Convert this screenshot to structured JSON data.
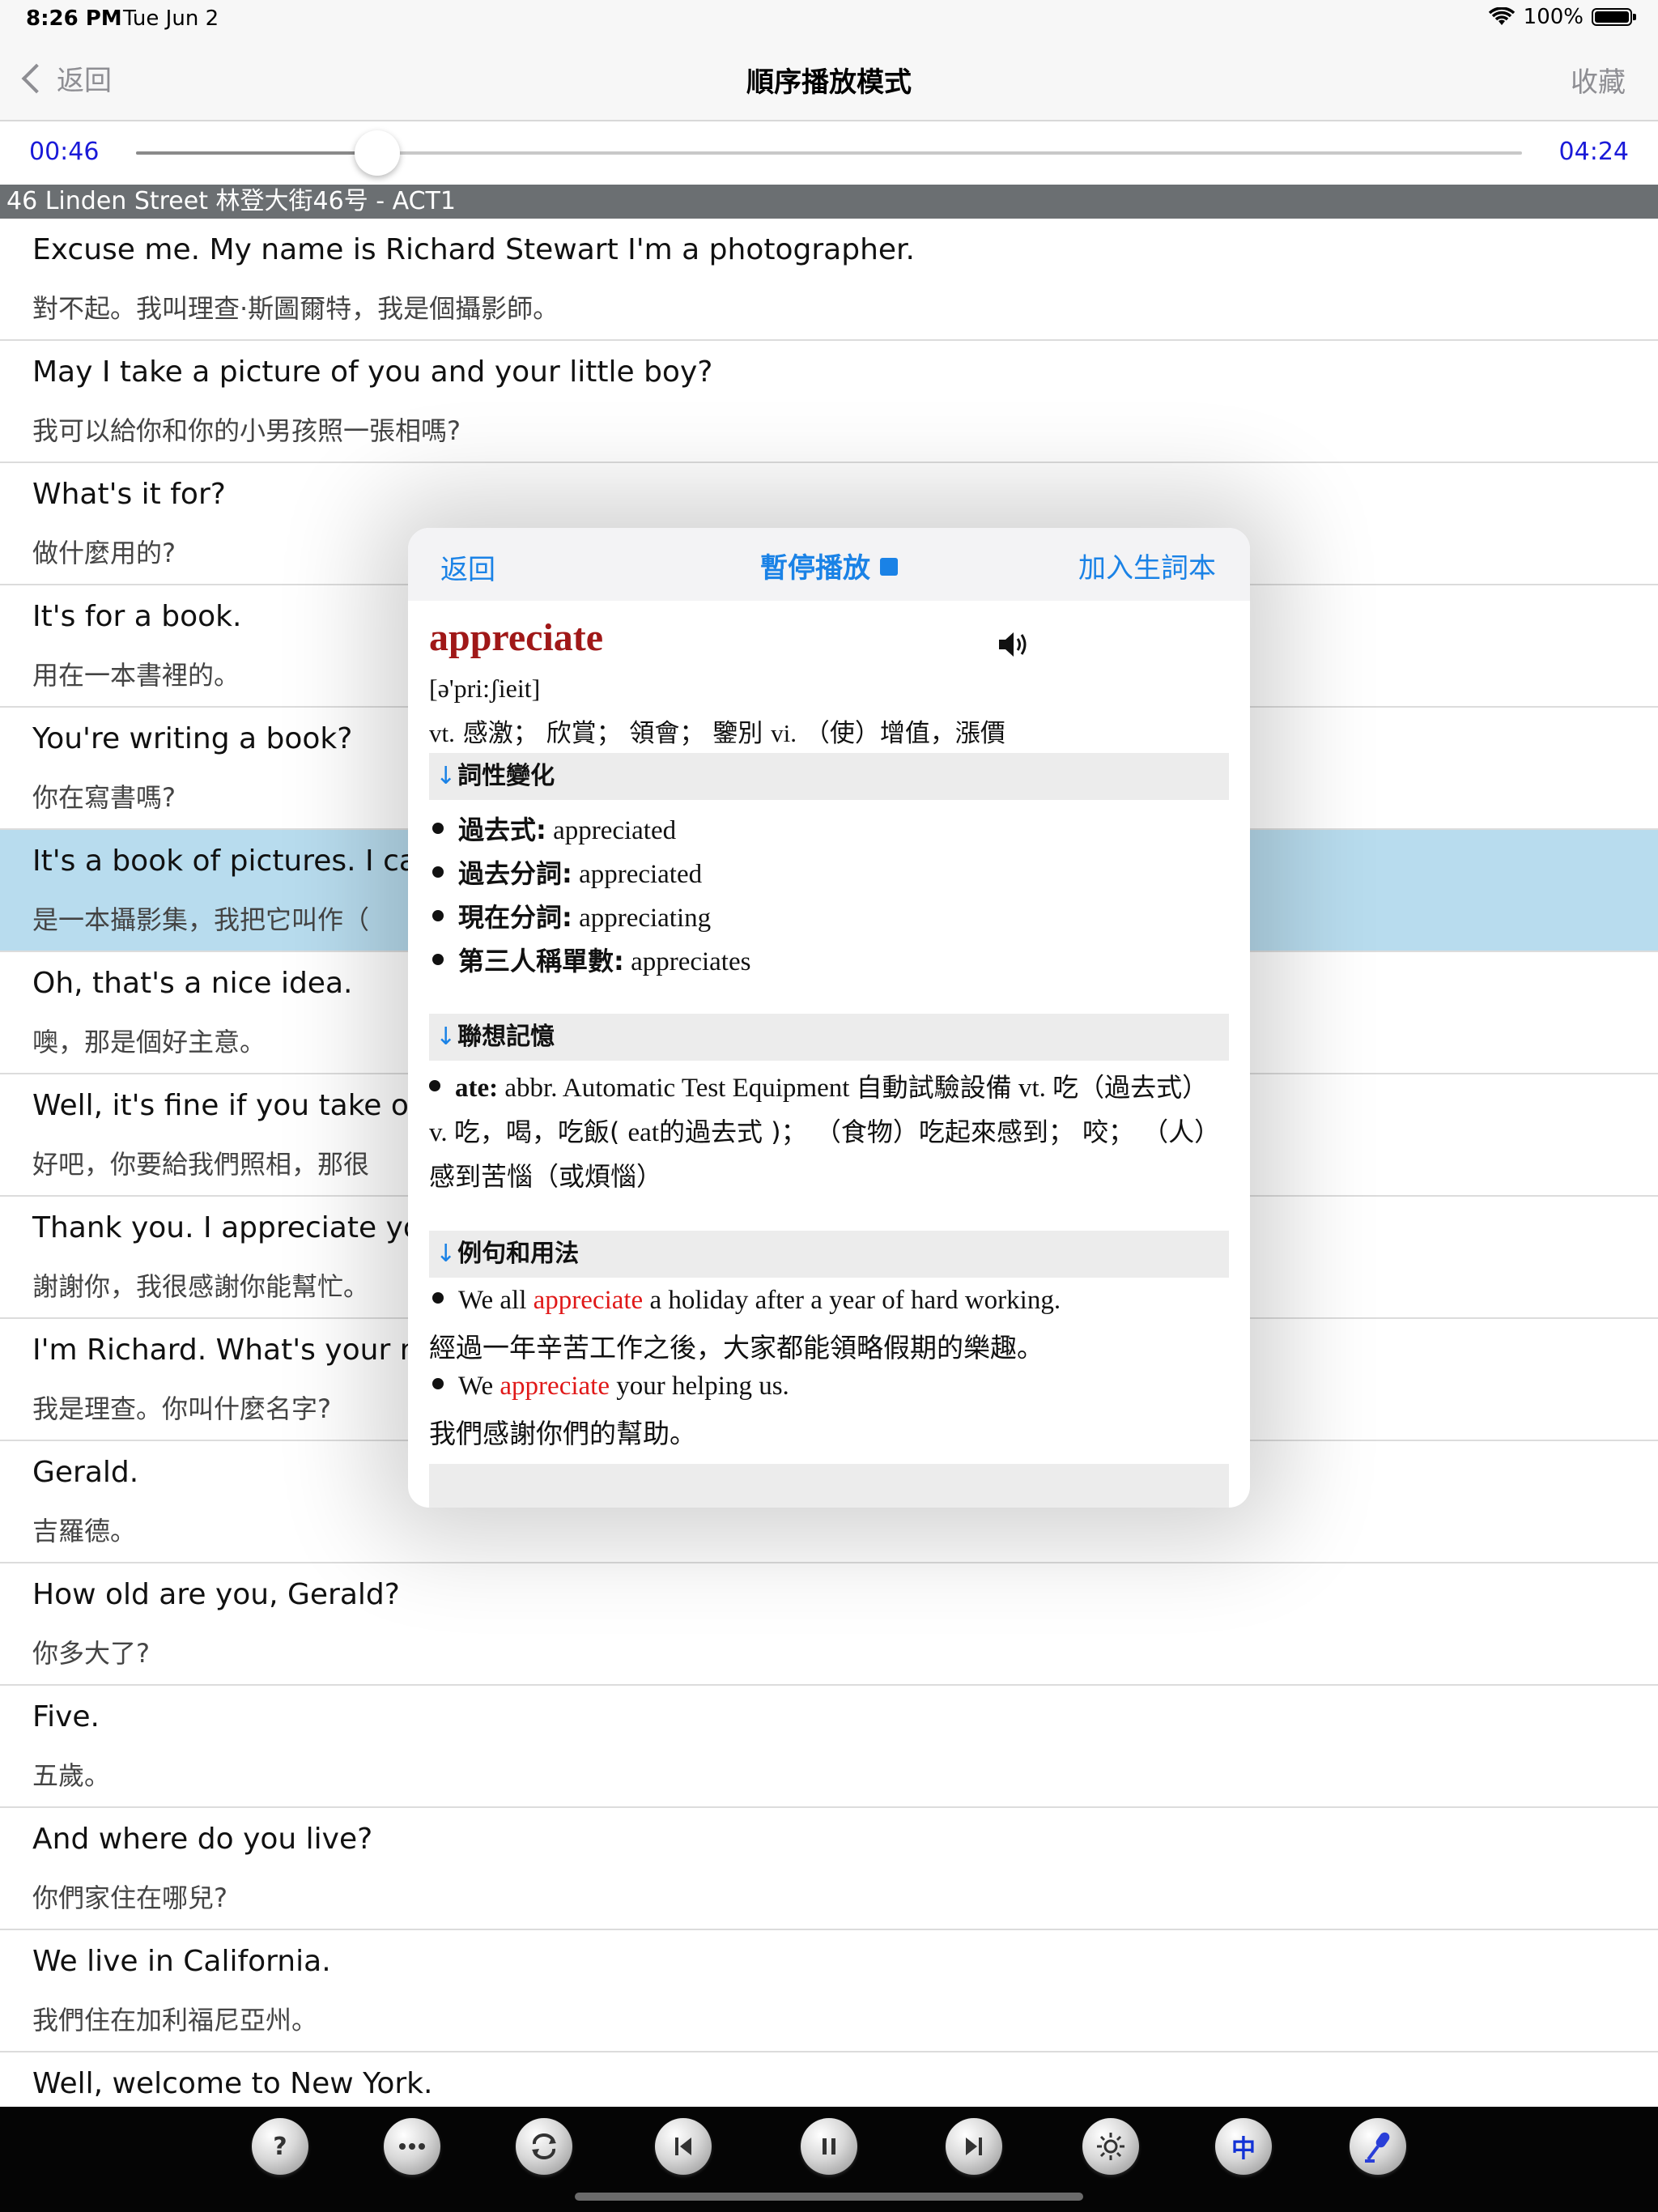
{
  "status_bar": {
    "time": "8:26 PM",
    "date": "Tue Jun 2",
    "battery": "100%"
  },
  "nav": {
    "back_label": "返回",
    "title": "順序播放模式",
    "favorite_label": "收藏"
  },
  "progress": {
    "current": "00:46",
    "total": "04:24",
    "fraction": 0.174
  },
  "section_title": "46 Linden Street 林登大街46号 - ACT1",
  "sentences": [
    {
      "en": "Excuse me.  My name is   Richard Stewart  I'm a photographer.",
      "zh": "對不起。我叫理查·斯圖爾特，我是個攝影師。"
    },
    {
      "en": "May I  take a picture of you and your little boy?",
      "zh": "我可以給你和你的小男孩照一張相嗎?"
    },
    {
      "en": "What's it for?",
      "zh": "做什麼用的?"
    },
    {
      "en": "It's for a book.",
      "zh": "用在一本書裡的。"
    },
    {
      "en": "You're writing a book?",
      "zh": "你在寫書嗎?"
    },
    {
      "en": "It's a book of pictures. I call",
      "zh": "是一本攝影集，我把它叫作（"
    },
    {
      "en": "Oh, that's a nice idea.",
      "zh": "噢，那是個好主意。"
    },
    {
      "en": "Well, it's fine if you take our",
      "zh": "好吧，你要給我們照相，那很"
    },
    {
      "en": "Thank you. I appreciate you",
      "zh": "謝謝你，我很感謝你能幫忙。"
    },
    {
      "en": "I'm  Richard. What's your na",
      "zh": "我是理查。你叫什麼名字?"
    },
    {
      "en": "Gerald.",
      "zh": "吉羅德。"
    },
    {
      "en": "How old are you, Gerald?",
      "zh": "你多大了?"
    },
    {
      "en": "Five.",
      "zh": "五歲。"
    },
    {
      "en": "And where do you live?",
      "zh": "你們家住在哪兒?"
    },
    {
      "en": "We live in  California.",
      "zh": "我們住在加利福尼亞州。"
    },
    {
      "en": "Well, welcome to New York.",
      "zh": ""
    }
  ],
  "popup": {
    "back_label": "返回",
    "pause_label": "暫停播放",
    "add_label": "加入生詞本",
    "word": "appreciate",
    "phonetic": "[ə'pri:ʃieit]",
    "definition_vt": "vt.",
    "definition_vt_text": " 感激； 欣賞； 領會； 鑒別 ",
    "definition_vi": "vi.",
    "definition_vi_text": " （使）增值，漲價",
    "sect_forms": "詞性變化",
    "forms": [
      {
        "label": "過去式:",
        "value": " appreciated"
      },
      {
        "label": "過去分詞:",
        "value": " appreciated"
      },
      {
        "label": "現在分詞:",
        "value": " appreciating"
      },
      {
        "label": "第三人稱單數:",
        "value": " appreciates"
      }
    ],
    "sect_memory": "聯想記憶",
    "memory_word": "ate:",
    "memory_text_1": " abbr. Automatic Test Equipment ",
    "memory_text_2": "自動試驗設備",
    "memory_text_3": " vt. ",
    "memory_text_4": "吃（過去式） ",
    "memory_text_5": "v. ",
    "memory_text_6": "吃，喝，吃飯( ",
    "memory_text_7": "eat",
    "memory_text_8": "的過去式 )； （食物）吃起來感到； 咬； （人）感到苦惱（或煩惱）",
    "sect_examples": "例句和用法",
    "examples": [
      {
        "pre": "We all ",
        "hl": "appreciate",
        "post": " a holiday after a year of hard working.",
        "zh": "經過一年辛苦工作之後，大家都能領略假期的樂趣。"
      },
      {
        "pre": "We ",
        "hl": "appreciate",
        "post": " your helping us.",
        "zh": "我們感謝你們的幫助。"
      }
    ]
  },
  "toolbar": {
    "buttons": [
      "help",
      "more",
      "repeat",
      "previous",
      "pause",
      "next",
      "brightness",
      "chinese",
      "record"
    ],
    "zh_label": "中",
    "help_label": "?"
  }
}
